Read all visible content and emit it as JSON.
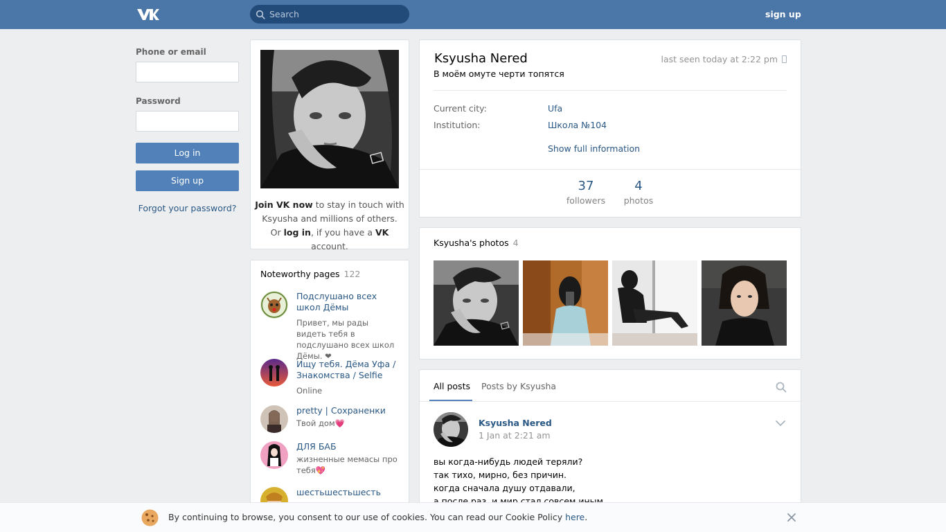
{
  "header": {
    "search_placeholder": "Search",
    "signup_label": "sign up",
    "brand_color": "#4a76a8"
  },
  "login": {
    "phone_label": "Phone or email",
    "phone_value": "",
    "password_label": "Password",
    "password_value": "",
    "login_button": "Log in",
    "signup_button": "Sign up",
    "forgot_link": "Forgot your password?"
  },
  "avatar_card": {
    "join_bold": "Join VK now",
    "join_rest": " to stay in touch with Ksyusha and millions of others.",
    "or_text": "Or ",
    "login_bold": "log in",
    "if_text": ", if you have a ",
    "vk_bold": "VK",
    "account_text": " account."
  },
  "noteworthy": {
    "title": "Noteworthy pages",
    "count": "122",
    "items": [
      {
        "name": "Подслушано всех школ Дёмы",
        "desc": "Привет, мы рады видеть тебя в подслушано всех школ Дёмы. ❤"
      },
      {
        "name": "Ищу тебя. Дёма Уфа / Знакомства / Selfie",
        "desc": "Online"
      },
      {
        "name": "pretty | Сохраненки",
        "desc": "Твой дом💗"
      },
      {
        "name": "ДЛЯ БАБ",
        "desc": "жизненные мемасы про тебя💖"
      },
      {
        "name": "шестьшестьшесть",
        "desc": ""
      }
    ]
  },
  "profile": {
    "name": "Ksyusha Nered",
    "status": "В моём омуте черти топятся",
    "last_seen": "last seen today at 2:22 pm",
    "city_label": "Current city:",
    "city_value": "Ufa",
    "institution_label": "Institution:",
    "institution_value": "Школа №104",
    "show_full": "Show full information",
    "followers_count": "37",
    "followers_label": "followers",
    "photos_count": "4",
    "photos_label": "photos"
  },
  "photos": {
    "title": "Ksyusha's photos",
    "count": "4"
  },
  "wall": {
    "tab_all": "All posts",
    "tab_by": "Posts by Ksyusha",
    "post": {
      "author": "Ksyusha Nered",
      "date": "1 Jan at 2:21 am",
      "text": "вы когда-нибудь людей теряли?\nтак тихо, мирно, без причин.\nкогда сначала душу отдавали,\nа после раз, и мир стал совсем иным."
    }
  },
  "cookie": {
    "text": "By continuing to browse, you consent to our use of cookies. You can read our Cookie Policy ",
    "link": "here",
    "end": "."
  }
}
